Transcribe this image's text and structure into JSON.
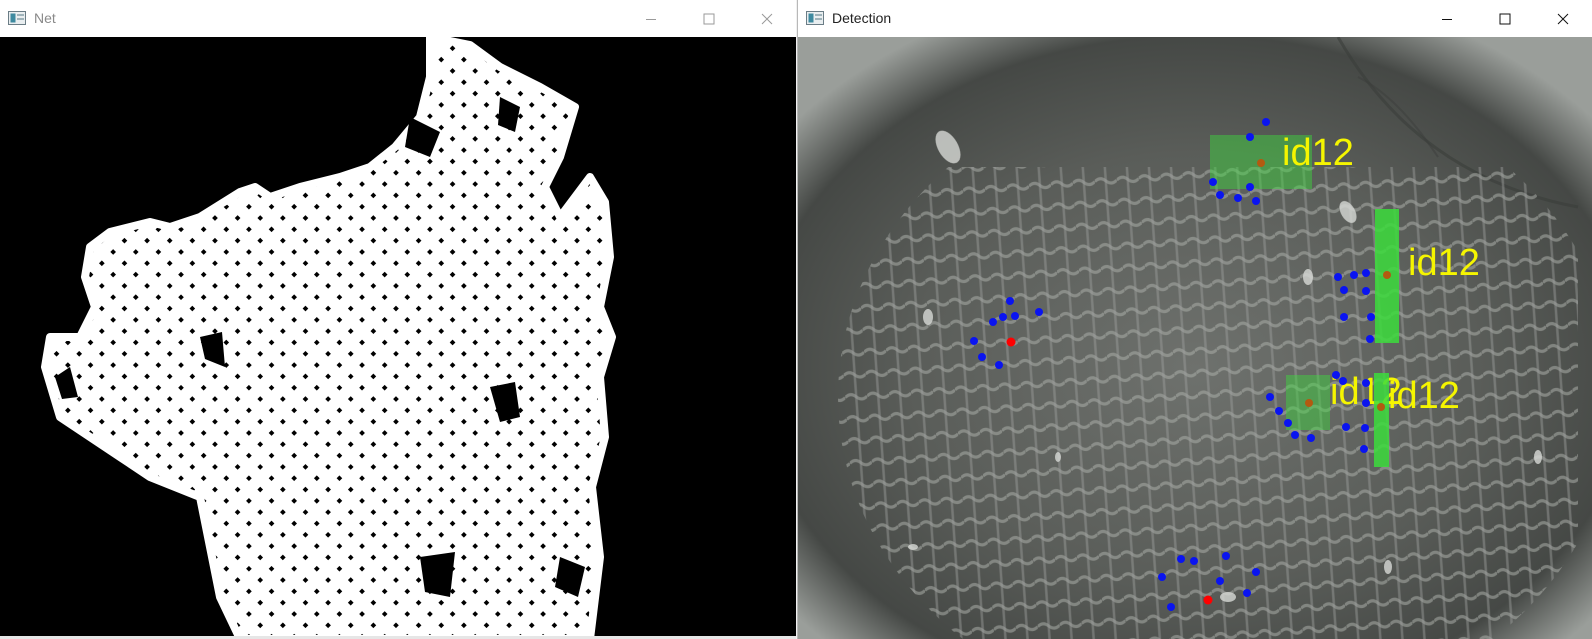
{
  "windows": [
    {
      "title": "Net",
      "controls": {
        "minimize": "minimize-icon",
        "maximize": "maximize-icon",
        "close": "close-icon"
      },
      "content": "binary-mask-image"
    },
    {
      "title": "Detection",
      "controls": {
        "minimize": "minimize-icon",
        "maximize": "maximize-icon",
        "close": "close-icon"
      },
      "content": "camera-frame-with-detections",
      "detections": [
        {
          "label": "id12"
        },
        {
          "label": "id12"
        },
        {
          "label": "id12"
        },
        {
          "label": "id12"
        }
      ]
    }
  ],
  "colors": {
    "detection_box": "#3cdc3c",
    "label_text": "#f5f500",
    "keypoint_blue": "#0a14f0",
    "keypoint_red": "#ff0000",
    "center_point": "#b35a10"
  }
}
